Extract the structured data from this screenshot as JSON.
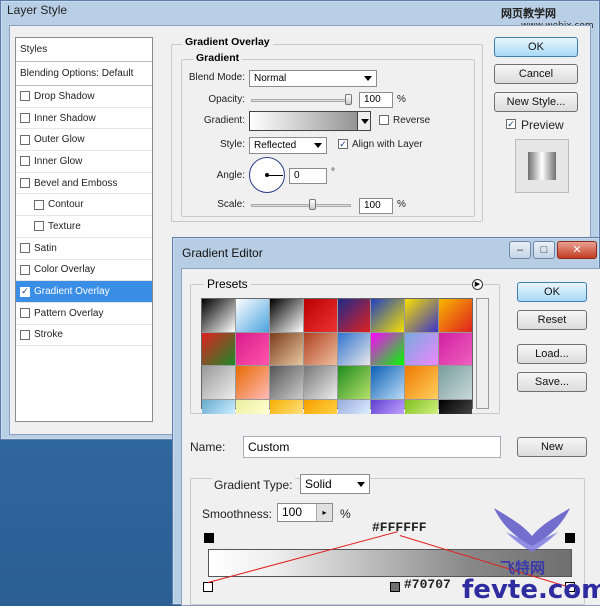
{
  "layer_style": {
    "title": "Layer Style",
    "watermark_top": "网页教学网",
    "watermark_url": "www.webjx.com",
    "sidebar": [
      {
        "label": "Styles",
        "checked": null,
        "indent": false,
        "selected": false,
        "head": true
      },
      {
        "label": "Blending Options: Default",
        "checked": null,
        "indent": false,
        "selected": false,
        "head": true
      },
      {
        "label": "Drop Shadow",
        "checked": false,
        "indent": false,
        "selected": false
      },
      {
        "label": "Inner Shadow",
        "checked": false,
        "indent": false,
        "selected": false
      },
      {
        "label": "Outer Glow",
        "checked": false,
        "indent": false,
        "selected": false
      },
      {
        "label": "Inner Glow",
        "checked": false,
        "indent": false,
        "selected": false
      },
      {
        "label": "Bevel and Emboss",
        "checked": false,
        "indent": false,
        "selected": false
      },
      {
        "label": "Contour",
        "checked": false,
        "indent": true,
        "selected": false
      },
      {
        "label": "Texture",
        "checked": false,
        "indent": true,
        "selected": false
      },
      {
        "label": "Satin",
        "checked": false,
        "indent": false,
        "selected": false
      },
      {
        "label": "Color Overlay",
        "checked": false,
        "indent": false,
        "selected": false
      },
      {
        "label": "Gradient Overlay",
        "checked": true,
        "indent": false,
        "selected": true
      },
      {
        "label": "Pattern Overlay",
        "checked": false,
        "indent": false,
        "selected": false
      },
      {
        "label": "Stroke",
        "checked": false,
        "indent": false,
        "selected": false
      }
    ],
    "section_title": "Gradient Overlay",
    "group_title": "Gradient",
    "blend_mode_label": "Blend Mode:",
    "blend_mode": "Normal",
    "opacity_label": "Opacity:",
    "opacity": "100",
    "opacity_unit": "%",
    "gradient_label": "Gradient:",
    "reverse_label": "Reverse",
    "style_label": "Style:",
    "style": "Reflected",
    "align_label": "Align with Layer",
    "angle_label": "Angle:",
    "angle": "0",
    "angle_unit": "°",
    "scale_label": "Scale:",
    "scale": "100",
    "scale_unit": "%",
    "ok": "OK",
    "cancel": "Cancel",
    "new_style": "New Style...",
    "preview_label": "Preview"
  },
  "gradient_editor": {
    "title": "Gradient Editor",
    "presets_label": "Presets",
    "ok": "OK",
    "reset": "Reset",
    "load": "Load...",
    "save": "Save...",
    "name_label": "Name:",
    "name_value": "Custom",
    "new": "New",
    "gradient_type_label": "Gradient Type:",
    "gradient_type": "Solid",
    "smoothness_label": "Smoothness:",
    "smoothness": "100",
    "smoothness_unit": "%",
    "annotation_white": "#FFFFFF",
    "annotation_gray": "#70707",
    "watermark_brand": "飞特网",
    "watermark_site": "fevte.com",
    "swatch_colors": [
      [
        "#000",
        "#fff"
      ],
      [
        "#fff",
        "#4aa3df"
      ],
      [
        "#000",
        "#fff"
      ],
      [
        "#b00",
        "#e33"
      ],
      [
        "#1c2a8c",
        "#e02020"
      ],
      [
        "#1f3fc0",
        "#f5e000"
      ],
      [
        "#f8e000",
        "#3a33c8"
      ],
      [
        "#f8b800",
        "#e02020"
      ],
      [
        "#e02020",
        "#1a8a2a"
      ],
      [
        "#d81b8c",
        "#f5a"
      ],
      [
        "#7a3b1a",
        "#e8c9a0"
      ],
      [
        "#b04020",
        "#f0c0a0"
      ],
      [
        "#2f73d0",
        "#e8e8e8"
      ],
      [
        "#f0f",
        "#0f0"
      ],
      [
        "#7ad",
        "#e8f"
      ],
      [
        "#d020a0",
        "#f060c0"
      ],
      [
        "#999",
        "#eee"
      ],
      [
        "#e86a00",
        "#fbb"
      ],
      [
        "#555",
        "#ccc"
      ],
      [
        "#777",
        "#eee"
      ],
      [
        "#1f8a1f",
        "#b6e36b"
      ],
      [
        "#0a5fb4",
        "#bcdcf6"
      ],
      [
        "#f07a00",
        "#ffd060"
      ],
      [
        "#7a9ea0",
        "#c8d8d8"
      ],
      [
        "#6ac",
        "#cef"
      ],
      [
        "#e8f0a0",
        "#ffffd0"
      ],
      [
        "#f5b000",
        "#ffe080"
      ],
      [
        "#f5a000",
        "#ffd040"
      ],
      [
        "#9ad",
        "#def"
      ],
      [
        "#6040d0",
        "#c0a0ff"
      ],
      [
        "#80c020",
        "#d0f080"
      ],
      [
        "#000",
        "#444"
      ]
    ]
  }
}
